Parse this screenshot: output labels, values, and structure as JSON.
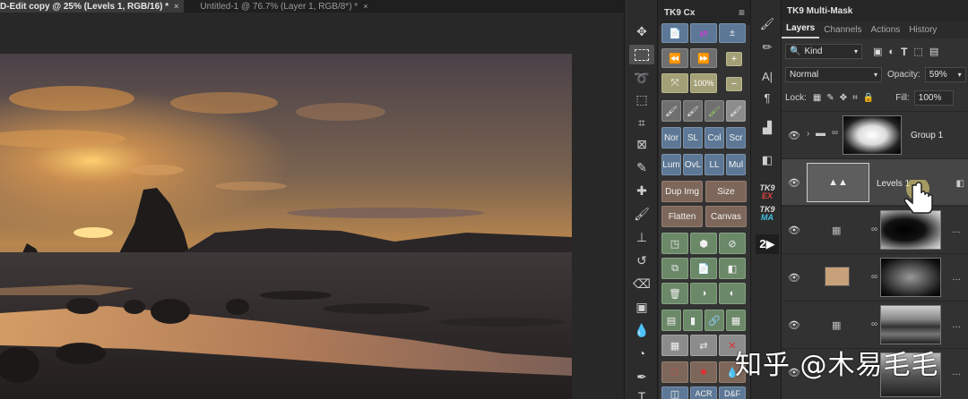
{
  "tabs": [
    {
      "label": "D-Edit copy @ 25% (Levels 1, RGB/16) *",
      "close": "×",
      "active": true
    },
    {
      "label": "Untitled-1 @ 76.7% (Layer 1, RGB/8*) *",
      "close": "×",
      "active": false
    }
  ],
  "tools": [
    "move-icon",
    "marquee-icon",
    "lasso-icon",
    "quick-select-icon",
    "crop-icon",
    "frame-icon",
    "eyedropper-icon",
    "healing-icon",
    "brush-icon",
    "stamp-icon",
    "history-brush-icon",
    "eraser-icon",
    "gradient-icon",
    "blur-icon",
    "dodge-icon",
    "pen-icon",
    "type-icon"
  ],
  "cx": {
    "title": "TK9 Cx",
    "menu": "≡",
    "pct_label": "100%",
    "blend_labels": [
      "Nor",
      "SL",
      "Col",
      "Scr",
      "Lum",
      "OvL",
      "LL",
      "Mul"
    ],
    "action_labels": [
      "Dup Img",
      "Size",
      "Flatten",
      "Canvas"
    ],
    "bottom_labels": [
      "ACR",
      "D&F"
    ]
  },
  "strip": {
    "tk9ex_top": "TK9",
    "tk9ex_bottom": "EX",
    "tk9ma_top": "TK9",
    "tk9ma_bottom": "MA"
  },
  "multimask": {
    "title": "TK9 Multi-Mask",
    "tabs": [
      "Layers",
      "Channels",
      "Actions",
      "History"
    ],
    "kind_label": "Kind",
    "blend_mode": "Normal",
    "opacity_label": "Opacity:",
    "opacity_value": "59%",
    "lock_label": "Lock:",
    "fill_label": "Fill:",
    "fill_value": "100%",
    "layers": [
      {
        "name": "Group 1"
      },
      {
        "name": "Levels 1"
      },
      {
        "name": ""
      },
      {
        "name": ""
      },
      {
        "name": ""
      }
    ]
  },
  "watermark": "知乎 @木易毛毛"
}
